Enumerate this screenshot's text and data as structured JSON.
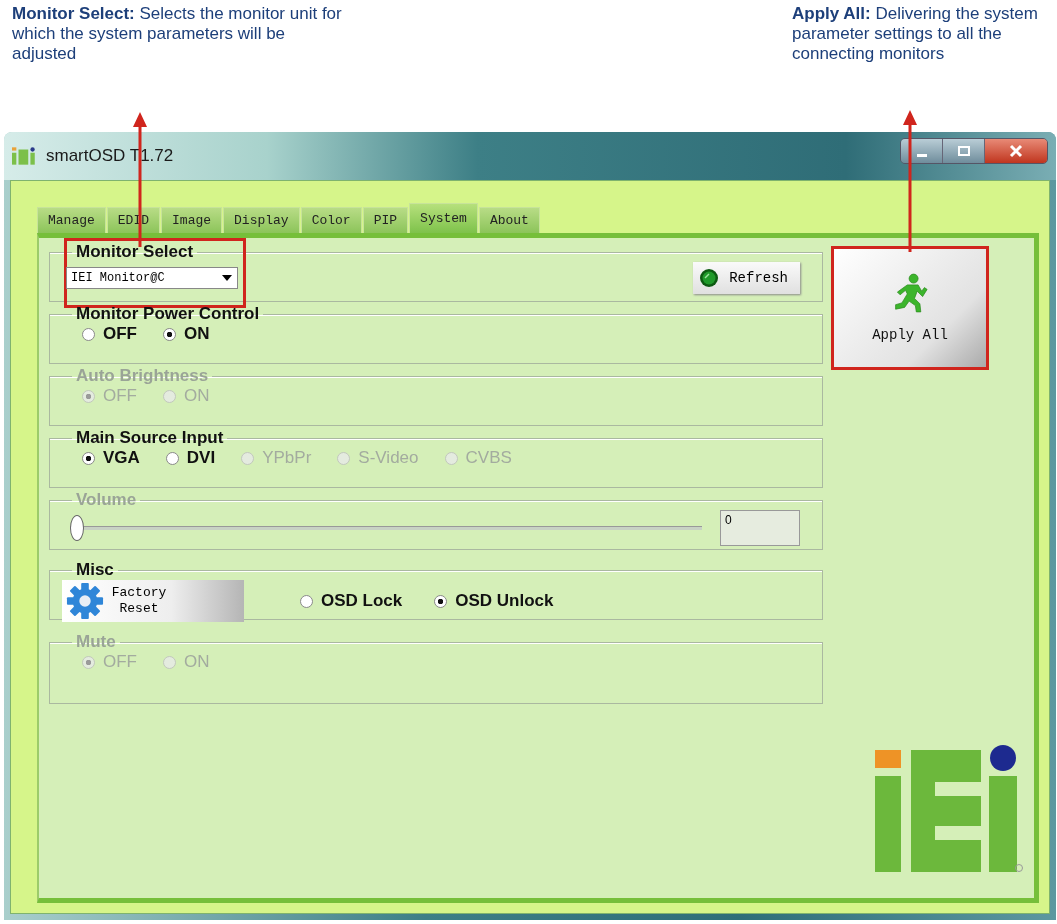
{
  "annotations": [
    {
      "text": "**Monitor Select:** Selects the monitor unit for which the system parameters will be adjusted"
    },
    {
      "text": "**Apply All:** Delivering the system parameter settings to all the connecting monitors"
    }
  ],
  "window": {
    "title": "smartOSD T1.72"
  },
  "tabs": [
    {
      "label": "Manage",
      "selected": false
    },
    {
      "label": "EDID",
      "selected": false
    },
    {
      "label": "Image",
      "selected": false
    },
    {
      "label": "Display",
      "selected": false
    },
    {
      "label": "Color",
      "selected": false
    },
    {
      "label": "PIP",
      "selected": false
    },
    {
      "label": "System",
      "selected": true
    },
    {
      "label": "About",
      "selected": false
    }
  ],
  "groups": [
    {
      "kind": "select",
      "title": "Monitor Select",
      "disabled": false,
      "highlighted": true,
      "value": "IEI Monitor@C",
      "button": "Refresh"
    },
    {
      "kind": "radio",
      "title": "Monitor Power Control",
      "disabled": false,
      "options": [
        {
          "label": "OFF",
          "selected": false,
          "disabled": false
        },
        {
          "label": "ON",
          "selected": true,
          "disabled": false
        }
      ]
    },
    {
      "kind": "radio",
      "title": "Auto Brightness",
      "disabled": true,
      "options": [
        {
          "label": "OFF",
          "selected": true,
          "disabled": true
        },
        {
          "label": "ON",
          "selected": false,
          "disabled": true
        }
      ]
    },
    {
      "kind": "radio",
      "title": "Main Source Input",
      "disabled": false,
      "options": [
        {
          "label": "VGA",
          "selected": true,
          "disabled": false
        },
        {
          "label": "DVI",
          "selected": false,
          "disabled": false
        },
        {
          "label": "YPbPr",
          "selected": false,
          "disabled": true
        },
        {
          "label": "S-Video",
          "selected": false,
          "disabled": true
        },
        {
          "label": "CVBS",
          "selected": false,
          "disabled": true
        }
      ]
    },
    {
      "kind": "slider",
      "title": "Volume",
      "disabled": true,
      "level": 0,
      "value": "0"
    },
    {
      "kind": "misc",
      "title": "Misc",
      "disabled": false,
      "button": "Factory Reset",
      "options": [
        {
          "label": "OSD Lock",
          "selected": false,
          "disabled": false
        },
        {
          "label": "OSD Unlock",
          "selected": true,
          "disabled": false
        }
      ]
    },
    {
      "kind": "radio",
      "title": "Mute",
      "disabled": true,
      "options": [
        {
          "label": "OFF",
          "selected": true,
          "disabled": true
        },
        {
          "label": "ON",
          "selected": false,
          "disabled": true
        }
      ]
    }
  ],
  "apply_button": {
    "label": "Apply All",
    "highlighted": true
  }
}
